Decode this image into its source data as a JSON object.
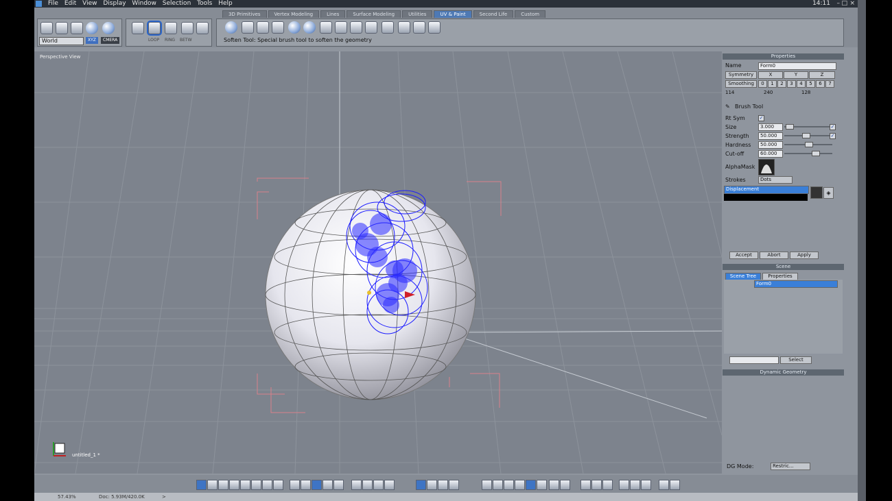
{
  "menu": {
    "items": [
      "File",
      "Edit",
      "View",
      "Display",
      "Window",
      "Selection",
      "Tools",
      "Help"
    ],
    "clock": "14:11"
  },
  "tabs": [
    "3D Primitives",
    "Vertex Modeling",
    "Lines",
    "Surface Modeling",
    "Utilities",
    "UV & Paint",
    "Second Life",
    "Custom"
  ],
  "active_tab": "UV & Paint",
  "transform": {
    "space": "World",
    "xyz": "XYZ",
    "camera": "CMERA"
  },
  "selection_modes": {
    "loop": "LOOP",
    "ring": "RING",
    "betw": "BETW"
  },
  "status_text": "Soften Tool: Special brush tool to soften the geometry",
  "viewport": {
    "label": "Perspective View",
    "doc_name": "untitled_1 *"
  },
  "properties": {
    "title": "Properties",
    "name_label": "Name",
    "name_value": "Form0",
    "symmetry_label": "Symmetry",
    "sym_axes": [
      "X",
      "Y",
      "Z"
    ],
    "smoothing_label": "Smoothing",
    "smoothing_levels": [
      "0",
      "1",
      "2",
      "3",
      "4",
      "5",
      "6",
      "7"
    ],
    "counts": [
      "114",
      "240",
      "128"
    ],
    "tool_name": "Brush Tool",
    "rt_sym_label": "Rt Sym",
    "size_label": "Size",
    "size_value": "3.000",
    "strength_label": "Strength",
    "strength_value": "50.000",
    "hardness_label": "Hardness",
    "hardness_value": "50.000",
    "cutoff_label": "Cut-off",
    "cutoff_value": "60.000",
    "alphamask_label": "AlphaMask",
    "strokes_label": "Strokes",
    "strokes_value": "Dots",
    "layer": "Displacement",
    "accept": "Accept",
    "abort": "Abort",
    "apply": "Apply"
  },
  "scene": {
    "title": "Scene",
    "tab_tree": "Scene Tree",
    "tab_props": "Properties",
    "item": "Form0",
    "select": "Select"
  },
  "dynamic": {
    "title": "Dynamic Geometry",
    "dg_mode_label": "DG Mode:",
    "dg_mode_value": "Restric..."
  },
  "statusbar": {
    "zoom": "57.43%",
    "doc": "Doc: 5.93M/420.0K",
    "arrow": ">"
  },
  "colors": {
    "accent": "#4e79b4",
    "brush": "#1a1aff",
    "selection": "#3a7fd8"
  }
}
